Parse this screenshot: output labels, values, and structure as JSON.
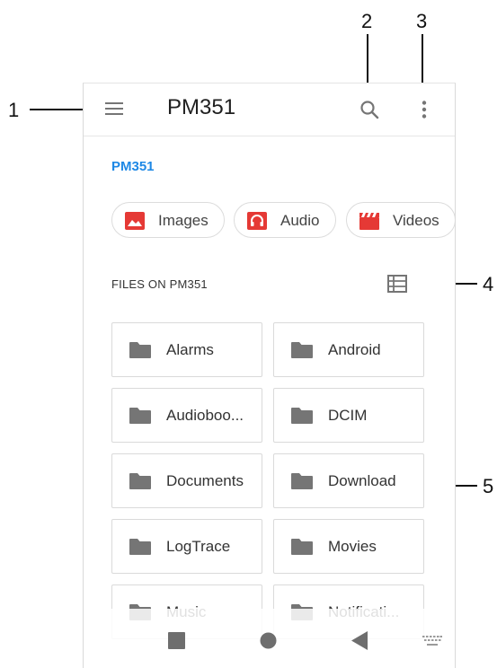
{
  "app_bar": {
    "title": "PM351",
    "menu_icon": "hamburger-menu-icon",
    "search_icon": "search-icon",
    "more_icon": "more-vertical-icon"
  },
  "breadcrumb": "PM351",
  "chips": [
    {
      "label": "Images",
      "icon": "image-icon",
      "color": "#e53935"
    },
    {
      "label": "Audio",
      "icon": "headphones-icon",
      "color": "#e53935"
    },
    {
      "label": "Videos",
      "icon": "clapperboard-icon",
      "color": "#e53935"
    }
  ],
  "section": {
    "label": "FILES ON PM351",
    "view_icon": "list-view-icon"
  },
  "folders": [
    {
      "name": "Alarms"
    },
    {
      "name": "Android"
    },
    {
      "name": "Audioboo..."
    },
    {
      "name": "DCIM"
    },
    {
      "name": "Documents"
    },
    {
      "name": "Download"
    },
    {
      "name": "LogTrace"
    },
    {
      "name": "Movies"
    },
    {
      "name": "Music"
    },
    {
      "name": "Notificati..."
    }
  ],
  "nav_bar": {
    "recents_icon": "square-recents-icon",
    "home_icon": "circle-home-icon",
    "back_icon": "triangle-back-icon",
    "keyboard_icon": "keyboard-icon"
  },
  "callouts": [
    "1",
    "2",
    "3",
    "4",
    "5"
  ],
  "colors": {
    "accent": "#1e88e5",
    "chip_icon": "#e53935",
    "folder_icon": "#757575"
  }
}
